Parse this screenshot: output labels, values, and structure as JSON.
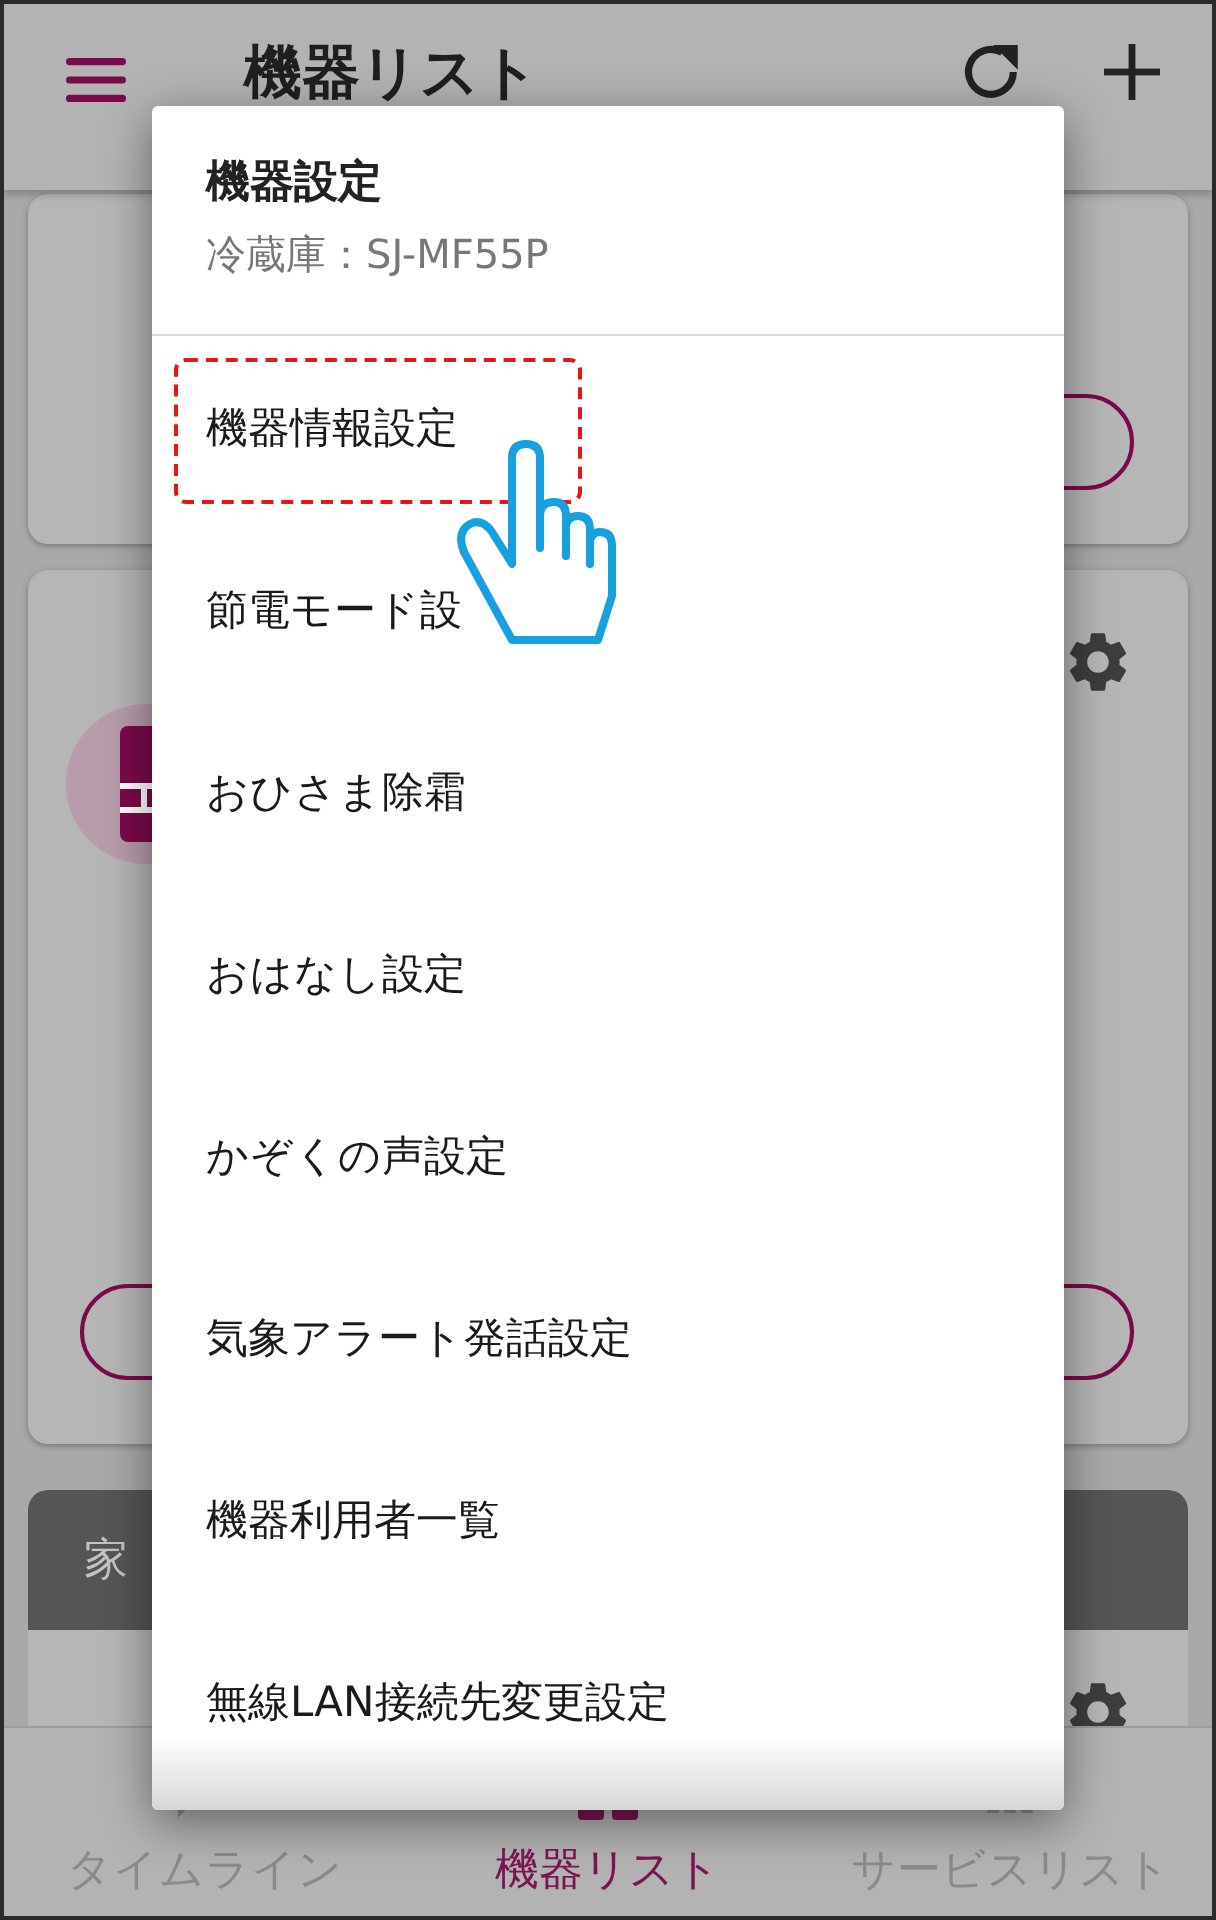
{
  "app_bar": {
    "title": "機器リスト"
  },
  "section_header": {
    "title": "家"
  },
  "dialog": {
    "title": "機器設定",
    "subtitle": "冷蔵庫：SJ-MF55P",
    "items": [
      {
        "label": "機器情報設定",
        "highlighted": true
      },
      {
        "label": "節電モード設",
        "highlighted": false
      },
      {
        "label": "おひさま除霜",
        "highlighted": false
      },
      {
        "label": "おはなし設定",
        "highlighted": false
      },
      {
        "label": "かぞくの声設定",
        "highlighted": false
      },
      {
        "label": "気象アラート発話設定",
        "highlighted": false
      },
      {
        "label": "機器利用者一覧",
        "highlighted": false
      },
      {
        "label": "無線LAN接続先変更設定",
        "highlighted": false
      }
    ]
  },
  "bottom_nav": [
    {
      "label": "タイムライン",
      "selected": false
    },
    {
      "label": "機器リスト",
      "selected": true
    },
    {
      "label": "サービスリスト",
      "selected": false
    }
  ]
}
